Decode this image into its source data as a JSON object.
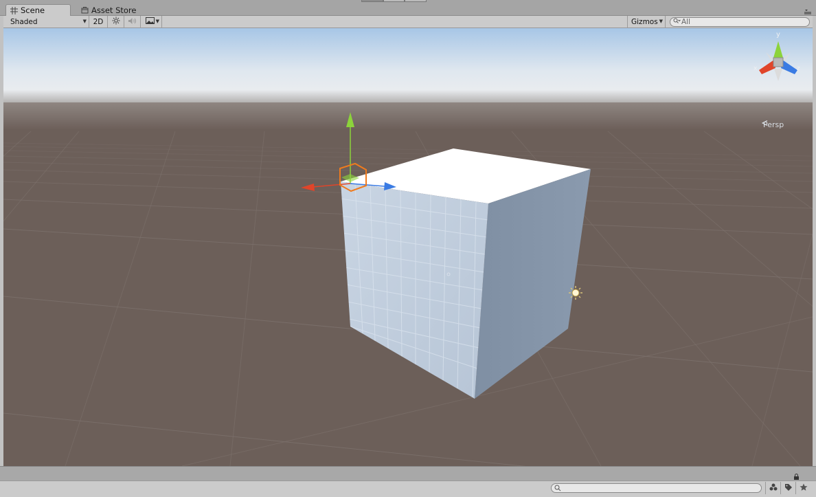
{
  "tabs": [
    {
      "label": "Scene",
      "icon": "grid-icon",
      "active": true
    },
    {
      "label": "Asset Store",
      "icon": "store-bag-icon",
      "active": false
    }
  ],
  "toolbar": {
    "shading_mode": "Shaded",
    "mode_2d_label": "2D",
    "gizmos_label": "Gizmos",
    "search_placeholder": "All",
    "icons": [
      "sun-lighting-icon",
      "speaker-audio-icon",
      "image-effects-icon"
    ]
  },
  "gizmo": {
    "projection_label": "Persp",
    "axis_y": "y",
    "axis_x": "x",
    "axis_z": "z",
    "colors": {
      "x": "#e0452a",
      "y": "#8cd33b",
      "z": "#3a7be3"
    }
  },
  "bottom_bar": {
    "icons": [
      "hierarchy-filter-icon",
      "tag-icon",
      "star-icon",
      "lock-icon"
    ]
  },
  "colors": {
    "ground": "#6c5f59",
    "sky_top": "#a8c8e8",
    "sky_horizon": "#e8edf2",
    "selection": "#f07b1d"
  }
}
